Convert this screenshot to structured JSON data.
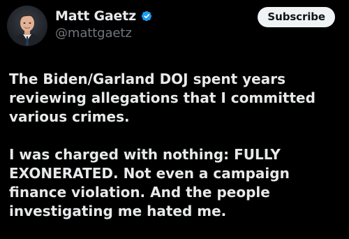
{
  "author": {
    "display_name": "Matt Gaetz",
    "handle": "@mattgaetz",
    "verified": true,
    "avatar_icon": "profile-photo",
    "verified_icon": "verified-badge-icon"
  },
  "actions": {
    "subscribe_label": "Subscribe"
  },
  "post": {
    "paragraphs": [
      "The Biden/Garland DOJ spent years reviewing allegations that I committed various crimes.",
      "I was charged with nothing: FULLY EXONERATED.  Not even a campaign finance violation.  And the people investigating me hated me."
    ]
  },
  "colors": {
    "background": "#000000",
    "text": "#e7e9ea",
    "secondary_text": "#71767b",
    "verified_blue": "#1d9bf0",
    "button_bg": "#eff3f4"
  }
}
